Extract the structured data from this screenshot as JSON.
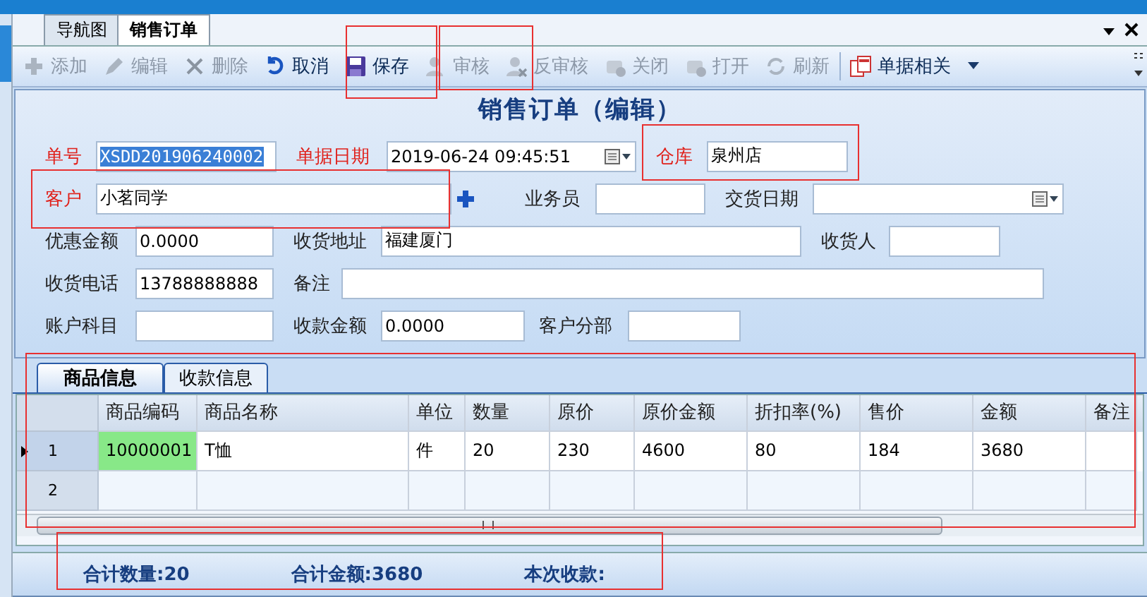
{
  "doc_tabs": [
    {
      "label": "导航图",
      "selected": false
    },
    {
      "label": "销售订单",
      "selected": true
    }
  ],
  "toolbar": [
    {
      "label": "添加",
      "disabled": true
    },
    {
      "label": "编辑",
      "disabled": true
    },
    {
      "label": "删除",
      "disabled": true
    },
    {
      "label": "取消",
      "disabled": false
    },
    {
      "label": "保存",
      "disabled": false
    },
    {
      "label": "审核",
      "disabled": true
    },
    {
      "label": "反审核",
      "disabled": true
    },
    {
      "label": "关闭",
      "disabled": true
    },
    {
      "label": "打开",
      "disabled": true
    },
    {
      "label": "刷新",
      "disabled": true
    },
    {
      "label": "单据相关",
      "disabled": false
    }
  ],
  "form": {
    "title": "销售订单（编辑）",
    "rows": [
      [
        {
          "label": "单号",
          "value": "XSDD201906240002",
          "required": true,
          "kind": "text",
          "selected": true
        },
        {
          "label": "单据日期",
          "value": "2019-06-24 09:45:51",
          "required": true,
          "kind": "date",
          "selected": false
        },
        {
          "label": "仓库",
          "value": "泉州店",
          "required": true,
          "kind": "text",
          "selected": false
        }
      ],
      [
        {
          "label": "客户",
          "value": "小茗同学",
          "required": true,
          "kind": "lookup",
          "selected": false
        },
        {
          "label": "业务员",
          "required": false,
          "kind": "text"
        },
        {
          "label": "交货日期",
          "required": false,
          "kind": "date"
        }
      ],
      [
        {
          "label": "优惠金额",
          "value": "0.0000",
          "required": false,
          "kind": "text",
          "selected": false
        },
        {
          "label": "收货地址",
          "value": "福建厦门",
          "required": false,
          "kind": "text",
          "selected": false
        },
        {
          "label": "收货人",
          "required": false,
          "kind": "text"
        }
      ],
      [
        {
          "label": "收货电话",
          "value": "13788888888",
          "required": false,
          "kind": "text",
          "selected": false
        },
        {
          "label": "备注",
          "required": false,
          "kind": "text"
        }
      ],
      [
        {
          "label": "账户科目",
          "required": false,
          "kind": "text"
        },
        {
          "label": "收款金额",
          "value": "0.0000",
          "required": false,
          "kind": "text",
          "selected": false
        },
        {
          "label": "客户分部",
          "required": false,
          "kind": "text"
        }
      ]
    ]
  },
  "detail_tabs": [
    {
      "label": "商品信息",
      "selected": true
    },
    {
      "label": "收款信息",
      "selected": false
    }
  ],
  "table": {
    "columns": [
      "商品编码",
      "商品名称",
      "单位",
      "数量",
      "原价",
      "原价金额",
      "折扣率(%)",
      "售价",
      "金额",
      "备注"
    ],
    "rows": [
      {
        "number": "1",
        "selected": true,
        "cells": [
          {
            "text": "10000001",
            "highlighted": true
          },
          {
            "text": "T恤",
            "highlighted": false
          },
          {
            "text": "件",
            "highlighted": false
          },
          {
            "text": "20",
            "highlighted": false
          },
          {
            "text": "230",
            "highlighted": false
          },
          {
            "text": "4600",
            "highlighted": false
          },
          {
            "text": "80",
            "highlighted": false
          },
          {
            "text": "184",
            "highlighted": false
          },
          {
            "text": "3680",
            "highlighted": false
          }
        ]
      },
      {
        "number": "2",
        "selected": false,
        "cells": []
      }
    ]
  },
  "totals": [
    "合计数量:20",
    "合计金额:3680",
    "本次收款:"
  ]
}
